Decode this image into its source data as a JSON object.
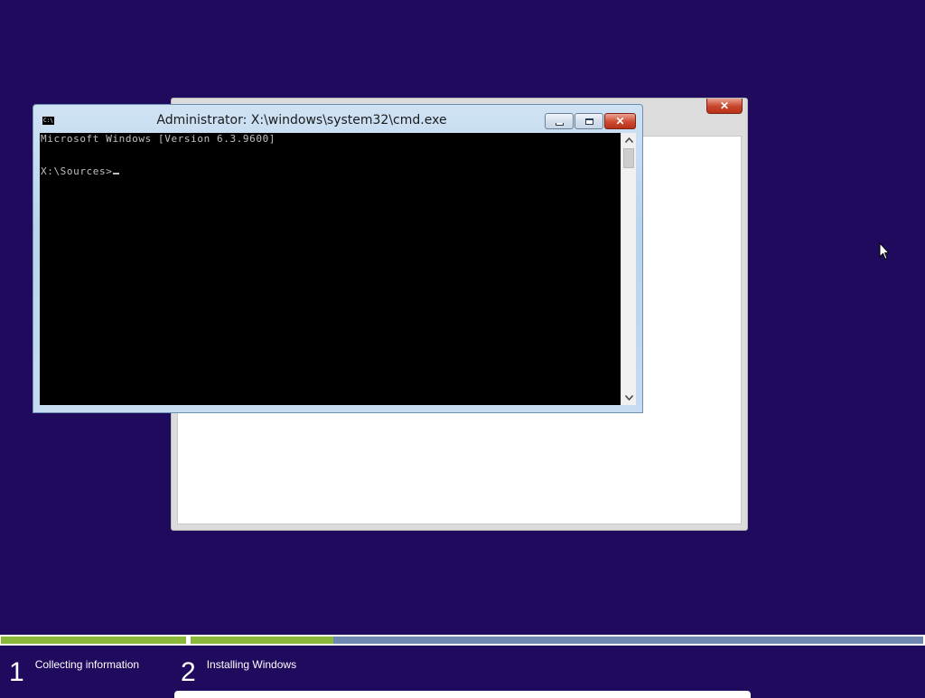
{
  "setup_window": {
    "close_glyph": "✕"
  },
  "cmd_window": {
    "title": "Administrator: X:\\windows\\system32\\cmd.exe",
    "icon_text": "C:\\",
    "minimize_icon": "minimize-icon",
    "maximize_icon": "maximize-icon",
    "close_glyph": "✕",
    "console_lines": [
      "Microsoft Windows [Version 6.3.9600]",
      "X:\\Sources>"
    ]
  },
  "progress": {
    "steps": [
      {
        "number": "1",
        "label": "Collecting information",
        "fill": 1.0
      },
      {
        "number": "2",
        "label": "Installing Windows",
        "fill": 0.195
      }
    ],
    "fill_color": "#8ab83a",
    "track_color": "#6f88b2"
  },
  "colors": {
    "desktop_background": "#200a5e"
  }
}
